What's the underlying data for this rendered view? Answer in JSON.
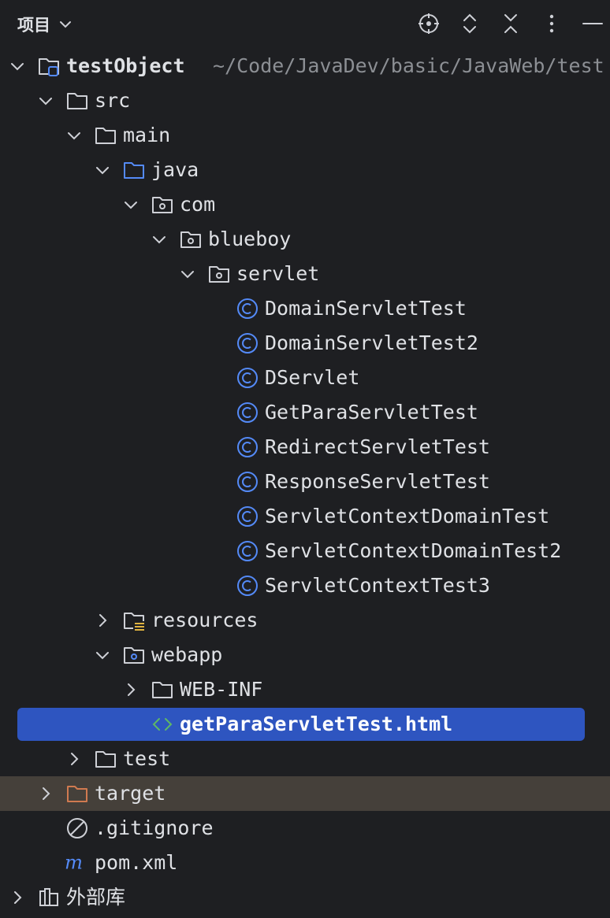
{
  "header": {
    "title": "项目",
    "icons": [
      "locate-icon",
      "expand-all-icon",
      "collapse-all-icon",
      "more-options-icon",
      "hide-icon"
    ]
  },
  "tree": {
    "root": {
      "label": "testObject",
      "path": "~/Code/JavaDev/basic/JavaWeb/test"
    },
    "src": "src",
    "main": "main",
    "java": "java",
    "com": "com",
    "blueboy": "blueboy",
    "servlet": "servlet",
    "classes": [
      "DomainServletTest",
      "DomainServletTest2",
      "DServlet",
      "GetParaServletTest",
      "RedirectServletTest",
      "ResponseServletTest",
      "ServletContextDomainTest",
      "ServletContextDomainTest2",
      "ServletContextTest3"
    ],
    "resources": "resources",
    "webapp": "webapp",
    "webinf": "WEB-INF",
    "html_file": "getParaServletTest.html",
    "test": "test",
    "target": "target",
    "gitignore": ".gitignore",
    "pom": "pom.xml",
    "external_libs": "外部库"
  },
  "colors": {
    "background": "#1e1f22",
    "selection": "#2e55c0",
    "excluded_row": "#45403a",
    "class_icon": "#548af7",
    "folder_outline": "#ced0d6",
    "source_folder": "#548af7",
    "target_folder": "#d07a50",
    "maven_icon": "#548af7",
    "html_icon": "#5fb865"
  }
}
